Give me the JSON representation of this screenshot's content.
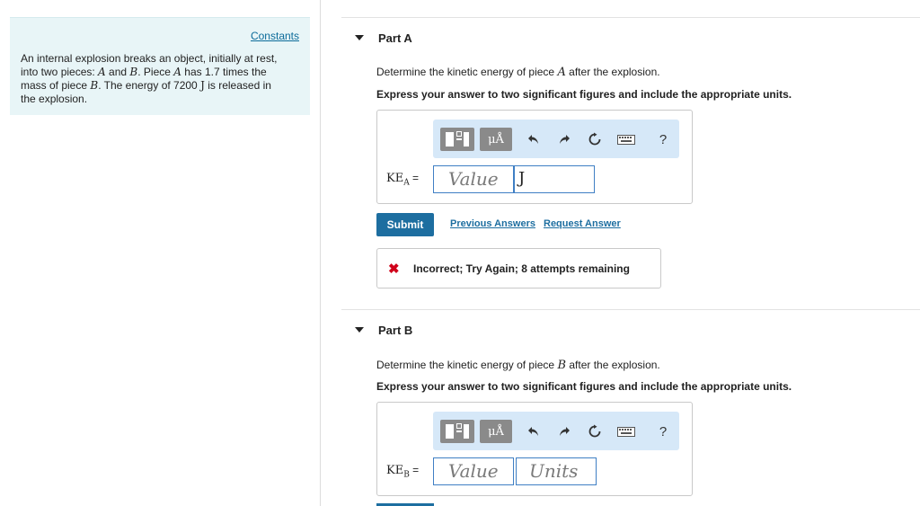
{
  "constants": {
    "link_label": "Constants",
    "problem_line1": "An internal explosion breaks an object, initially at rest,",
    "problem_line2a": "into two pieces: ",
    "problem_var_a": "A",
    "problem_line2b": " and ",
    "problem_var_b": "B",
    "problem_line2c": ". Piece ",
    "problem_var_a2": "A",
    "problem_line2d": " has 1.7 times the",
    "problem_line3a": "mass of piece ",
    "problem_var_b2": "B",
    "problem_line3b": ". The energy of 7200 ",
    "problem_unit": "J",
    "problem_line3c": " is released in",
    "problem_line4": "the explosion."
  },
  "toolbar": {
    "unit_label": "μÅ",
    "undo_icon": "undo-arrow-icon",
    "redo_icon": "redo-arrow-icon",
    "reset_icon": "reset-icon",
    "keyboard_icon": "keyboard-icon",
    "help_label": "?"
  },
  "part_a": {
    "title": "Part A",
    "question_prefix": "Determine the kinetic energy of piece ",
    "question_var": "A",
    "question_suffix": " after the explosion.",
    "instruction": "Express your answer to two significant figures and include the appropriate units.",
    "label_main": "KE",
    "label_sub": "A",
    "label_eq": " =",
    "value_placeholder": "Value",
    "unit_value": "J",
    "submit_label": "Submit",
    "previous_answers": "Previous Answers",
    "request_answer": "Request Answer",
    "feedback_icon": "✖",
    "feedback_text": "Incorrect; Try Again; 8 attempts remaining"
  },
  "part_b": {
    "title": "Part B",
    "question_prefix": "Determine the kinetic energy of piece ",
    "question_var": "B",
    "question_suffix": " after the explosion.",
    "instruction": "Express your answer to two significant figures and include the appropriate units.",
    "label_main": "KE",
    "label_sub": "B",
    "label_eq": " =",
    "value_placeholder": "Value",
    "units_placeholder": "Units"
  },
  "colors": {
    "accent": "#1d6ea0",
    "panel_bg": "#e8f5f7",
    "toolbar_bg": "#d6e8f8",
    "error": "#d0021b"
  }
}
